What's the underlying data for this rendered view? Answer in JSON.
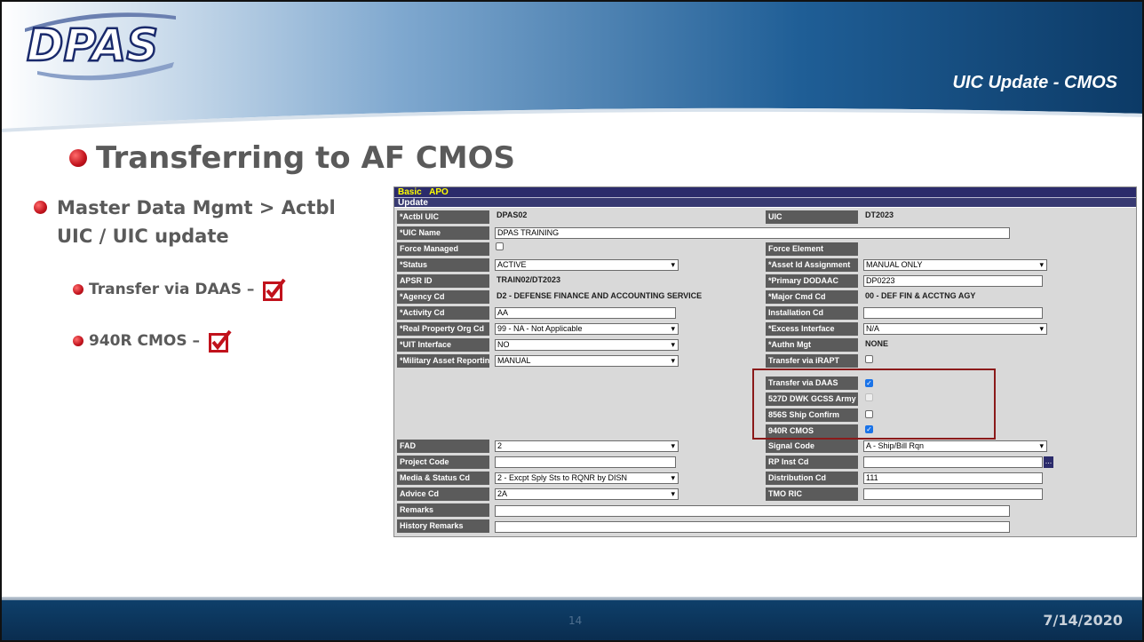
{
  "header": {
    "logo_text": "DPAS",
    "subtitle": "UIC Update - CMOS"
  },
  "title": "Transferring to AF CMOS",
  "bullets": {
    "main": "Master Data Mgmt > Actbl UIC / UIC update",
    "sub1": "Transfer via DAAS –",
    "sub2": "940R CMOS –"
  },
  "form": {
    "tabs": [
      "Basic",
      "APO"
    ],
    "section": "Update",
    "left": {
      "actbl_uic": {
        "label": "*Actbl UIC",
        "value": "DPAS02"
      },
      "uic_name": {
        "label": "*UIC Name",
        "value": "DPAS TRAINING"
      },
      "force_managed": {
        "label": "Force Managed",
        "checked": false
      },
      "status": {
        "label": "*Status",
        "value": "ACTIVE"
      },
      "apsr_id": {
        "label": "APSR ID",
        "value": "TRAIN02/DT2023"
      },
      "agency_cd": {
        "label": "*Agency Cd",
        "value": "D2 - DEFENSE FINANCE AND ACCOUNTING SERVICE"
      },
      "activity_cd": {
        "label": "*Activity Cd",
        "value": "AA"
      },
      "real_property": {
        "label": "*Real Property Org Cd",
        "value": "99 - NA - Not Applicable"
      },
      "uit_interface": {
        "label": "*UIT Interface",
        "value": "NO"
      },
      "military_asset": {
        "label": "*Military Asset Reporting",
        "value": "MANUAL"
      },
      "fad": {
        "label": "FAD",
        "value": "2"
      },
      "project_code": {
        "label": "Project Code",
        "value": ""
      },
      "media_status": {
        "label": "Media & Status Cd",
        "value": "2 - Excpt Sply Sts to RQNR by DISN"
      },
      "advice_cd": {
        "label": "Advice Cd",
        "value": "2A"
      },
      "remarks": {
        "label": "Remarks",
        "value": ""
      },
      "history_remarks": {
        "label": "History Remarks",
        "value": ""
      }
    },
    "right": {
      "uic": {
        "label": "UIC",
        "value": "DT2023"
      },
      "force_element": {
        "label": "Force Element",
        "value": ""
      },
      "asset_id": {
        "label": "*Asset Id Assignment",
        "value": "MANUAL ONLY"
      },
      "primary_dodaac": {
        "label": "*Primary DODAAC",
        "value": "DP0223"
      },
      "major_cmd": {
        "label": "*Major Cmd Cd",
        "value": "00 - DEF FIN & ACCTNG AGY"
      },
      "installation_cd": {
        "label": "Installation Cd",
        "value": ""
      },
      "excess_interface": {
        "label": "*Excess Interface",
        "value": "N/A"
      },
      "authn_mgt": {
        "label": "*Authn Mgt",
        "value": "NONE"
      },
      "transfer_irapt": {
        "label": "Transfer via iRAPT",
        "checked": false
      },
      "transfer_daas": {
        "label": "Transfer via DAAS",
        "checked": true
      },
      "dwk_gcss": {
        "label": "527D DWK GCSS Army",
        "checked": false
      },
      "ship_confirm": {
        "label": "856S Ship Confirm",
        "checked": false
      },
      "cmos": {
        "label": "940R CMOS",
        "checked": true
      },
      "signal_code": {
        "label": "Signal Code",
        "value": "A - Ship/Bill Rqn"
      },
      "rp_inst_cd": {
        "label": "RP Inst Cd",
        "value": ""
      },
      "distribution_cd": {
        "label": "Distribution Cd",
        "value": "111"
      },
      "tmo_ric": {
        "label": "TMO RIC",
        "value": ""
      }
    }
  },
  "footer": {
    "page": "14",
    "date": "7/14/2020"
  },
  "colors": {
    "accent_red": "#c1121c",
    "navy": "#2b2b6b",
    "header_blue": "#0d3a66"
  }
}
